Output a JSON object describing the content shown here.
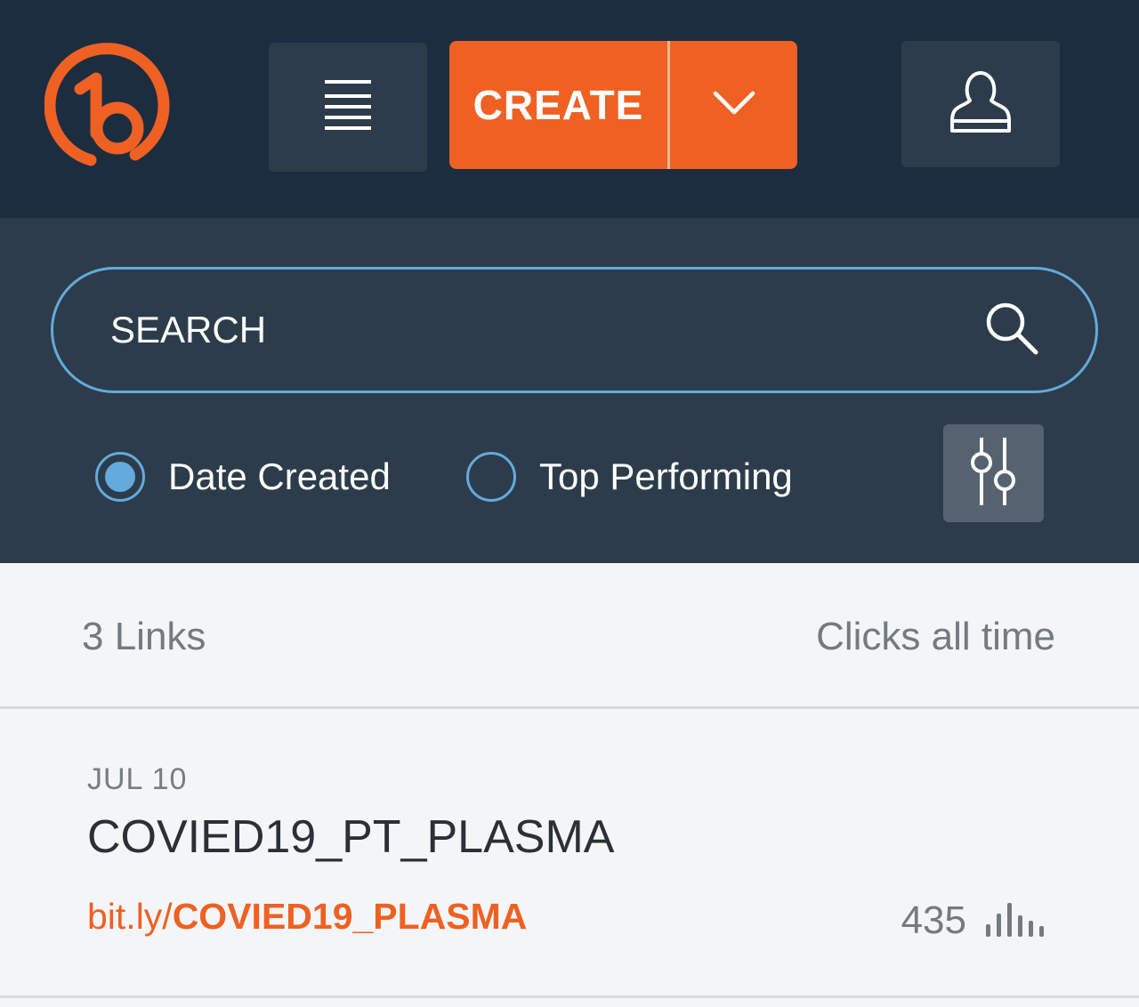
{
  "header": {
    "logo_icon": "bitly-logo-icon",
    "menu_icon": "hamburger-menu-icon",
    "create_label": "CREATE",
    "create_caret_icon": "chevron-down-icon",
    "account_icon": "user-icon",
    "brand_color": "#ee6123",
    "bar_color": "#1c2d40"
  },
  "filters": {
    "search_placeholder": "SEARCH",
    "search_icon": "search-icon",
    "sort_options": [
      {
        "label": "Date Created",
        "selected": true
      },
      {
        "label": "Top Performing",
        "selected": false
      }
    ],
    "filter_icon": "sliders-icon",
    "accent_color": "#64aadc"
  },
  "list": {
    "count_label": "3 Links",
    "clicks_label": "Clicks all time",
    "items": [
      {
        "date": "JUL 10",
        "title": "COVIED19_PT_PLASMA",
        "url_domain": "bit.ly/",
        "url_slug": "COVIED19_PLASMA",
        "clicks": "435",
        "chart_icon": "bar-chart-icon"
      }
    ]
  }
}
